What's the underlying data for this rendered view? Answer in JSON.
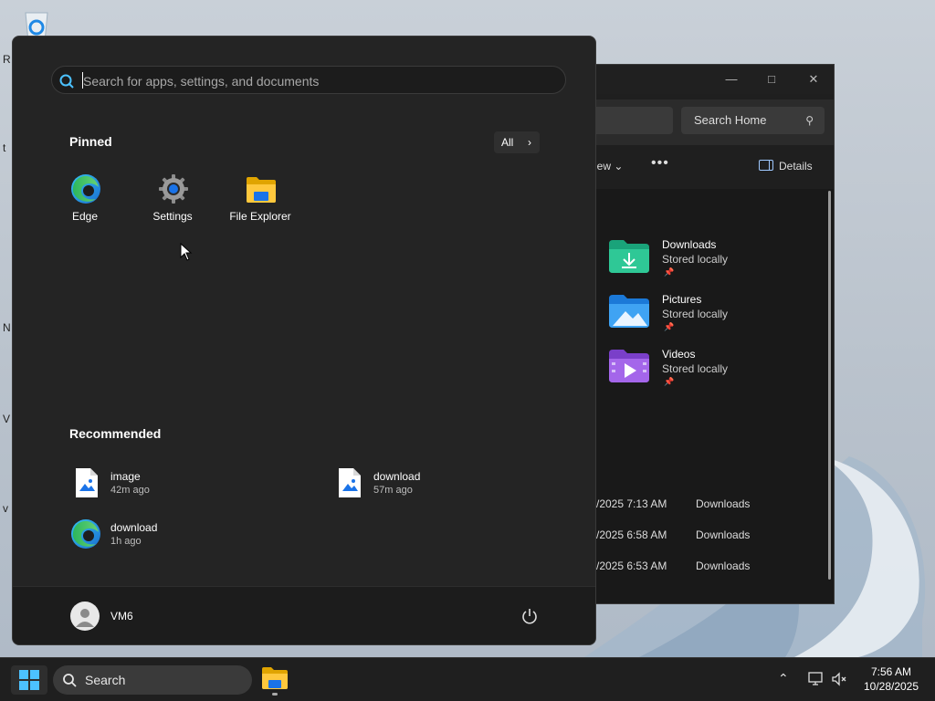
{
  "colors": {
    "start_bg": "#242424",
    "accent_blue": "#0078d4",
    "taskbar_bg": "#1f1f1f"
  },
  "start_menu": {
    "search_placeholder": "Search for apps, settings, and documents",
    "pinned_title": "Pinned",
    "all_label": "All",
    "pinned": [
      {
        "label": "Edge",
        "icon": "edge-icon"
      },
      {
        "label": "Settings",
        "icon": "settings-gear-icon"
      },
      {
        "label": "File Explorer",
        "icon": "file-explorer-icon"
      }
    ],
    "recommended_title": "Recommended",
    "recommended": [
      {
        "name": "image",
        "time": "42m ago",
        "icon": "image-file-icon"
      },
      {
        "name": "download",
        "time": "57m ago",
        "icon": "image-file-icon"
      },
      {
        "name": "download",
        "time": "1h ago",
        "icon": "edge-icon"
      }
    ],
    "user_name": "VM6"
  },
  "explorer": {
    "search_placeholder": "Search Home",
    "view_label": "iew",
    "details_label": "Details",
    "quick_access": [
      {
        "name": "Downloads",
        "status": "Stored locally"
      },
      {
        "name": "Pictures",
        "status": "Stored locally"
      },
      {
        "name": "Videos",
        "status": "Stored locally"
      }
    ],
    "recent": [
      {
        "date": "/2025 7:13 AM",
        "location": "Downloads"
      },
      {
        "date": "/2025 6:58 AM",
        "location": "Downloads"
      },
      {
        "date": "/2025 6:53 AM",
        "location": "Downloads"
      }
    ]
  },
  "taskbar": {
    "search_label": "Search",
    "time": "7:56 AM",
    "date": "10/28/2025"
  }
}
